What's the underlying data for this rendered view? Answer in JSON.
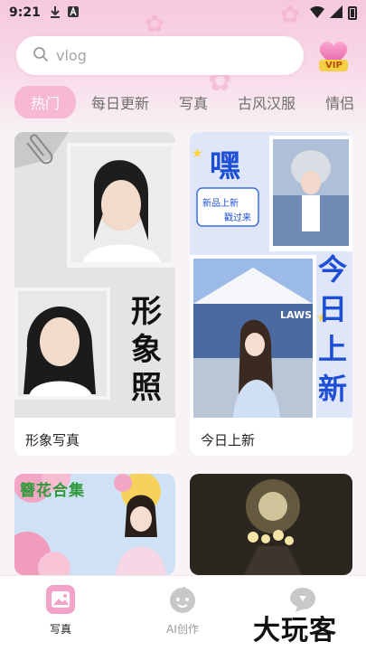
{
  "status_bar": {
    "time": "9:21",
    "download_icon": "download-icon",
    "a_icon": "a-icon",
    "wifi_icon": "wifi-icon",
    "signal_icon": "signal-icon",
    "battery_icon": "battery-icon"
  },
  "search": {
    "placeholder": "vlog",
    "icon": "search-icon"
  },
  "vip_badge": {
    "label": "VIP",
    "icon": "heart-icon"
  },
  "tabs": [
    {
      "label": "热门",
      "active": true
    },
    {
      "label": "每日更新",
      "active": false
    },
    {
      "label": "写真",
      "active": false
    },
    {
      "label": "古风汉服",
      "active": false
    },
    {
      "label": "情侣",
      "active": false
    }
  ],
  "cards": [
    {
      "label": "形象写真",
      "overlay_text": "形象照"
    },
    {
      "label": "今日上新",
      "overlay_text": "嘿",
      "overlay_text_2": "今日上新",
      "bubble_line1": "新品上新",
      "bubble_line2": "戳过来",
      "sign_text": "LAWS"
    },
    {
      "label": "",
      "overlay_text": "簪花合集"
    },
    {
      "label": ""
    }
  ],
  "bottom_nav": [
    {
      "label": "写真",
      "icon": "photo-icon",
      "active": true
    },
    {
      "label": "AI创作",
      "icon": "ai-face-icon",
      "active": false
    },
    {
      "label": "",
      "icon": "chat-bubble-icon",
      "active": false
    }
  ],
  "watermark": "大玩客",
  "colors": {
    "accent_pink": "#f7b9d2",
    "header_pink": "#f6c8de",
    "text_dark": "#222222",
    "text_muted": "#6e6e6e"
  }
}
